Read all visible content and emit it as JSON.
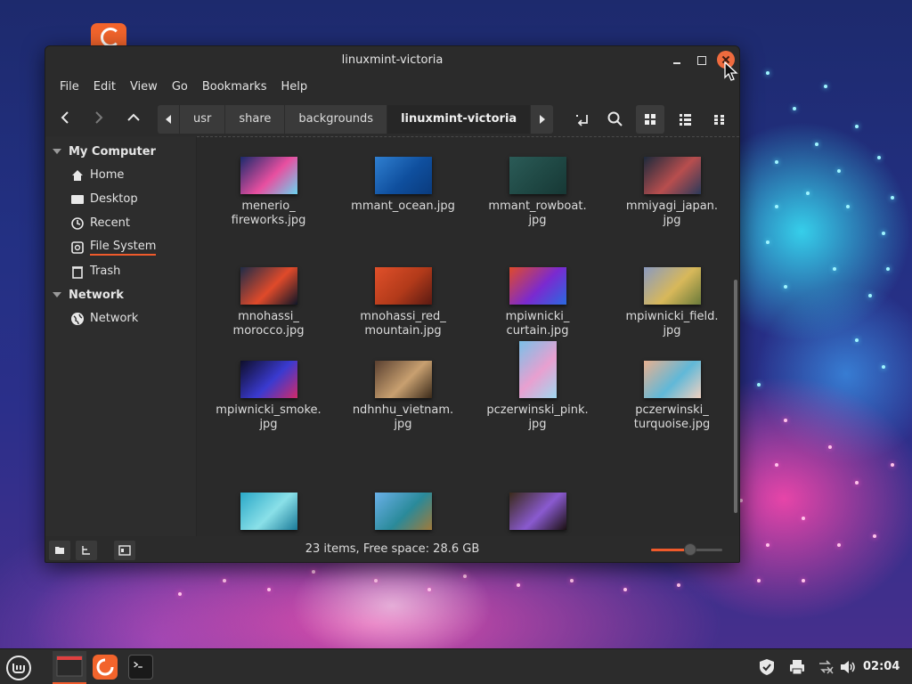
{
  "window": {
    "title": "linuxmint-victoria"
  },
  "menu": [
    "File",
    "Edit",
    "View",
    "Go",
    "Bookmarks",
    "Help"
  ],
  "breadcrumbs": [
    "usr",
    "share",
    "backgrounds",
    "linuxmint-victoria"
  ],
  "sidebar": {
    "sections": [
      {
        "title": "My Computer",
        "items": [
          {
            "label": "Home",
            "icon": "home-icon"
          },
          {
            "label": "Desktop",
            "icon": "desktop-icon"
          },
          {
            "label": "Recent",
            "icon": "clock-icon"
          },
          {
            "label": "File System",
            "icon": "drive-icon",
            "selected": true
          },
          {
            "label": "Trash",
            "icon": "trash-icon"
          }
        ]
      },
      {
        "title": "Network",
        "items": [
          {
            "label": "Network",
            "icon": "globe-icon"
          }
        ]
      }
    ]
  },
  "files": [
    {
      "name": "menerio_\nfireworks.jpg",
      "colors": [
        "#1a2a6c",
        "#e84fa0",
        "#6ad3f0"
      ],
      "tall": false
    },
    {
      "name": "mmant_ocean.jpg",
      "colors": [
        "#2f7fd0",
        "#0f4f9e",
        "#0a3b7d"
      ],
      "tall": false
    },
    {
      "name": "mmant_rowboat.\njpg",
      "colors": [
        "#2b5b57",
        "#1f4844",
        "#173835"
      ],
      "tall": false
    },
    {
      "name": "mmiyagi_japan.\njpg",
      "colors": [
        "#1c2a3c",
        "#b84e4e",
        "#2a3a5a"
      ],
      "tall": false
    },
    {
      "name": "mnohassi_\nmorocco.jpg",
      "colors": [
        "#1e2c48",
        "#e04a2a",
        "#0e1628"
      ],
      "tall": false
    },
    {
      "name": "mnohassi_red_\nmountain.jpg",
      "colors": [
        "#e0502a",
        "#b23a1a",
        "#5a1a12"
      ],
      "tall": false
    },
    {
      "name": "mpiwnicki_\ncurtain.jpg",
      "colors": [
        "#e04a2a",
        "#7a2ad0",
        "#2a6ae0"
      ],
      "tall": false
    },
    {
      "name": "mpiwnicki_field.\njpg",
      "colors": [
        "#8a9ac0",
        "#d8b85a",
        "#6a7a3a"
      ],
      "tall": false
    },
    {
      "name": "mpiwnicki_smoke.\njpg",
      "colors": [
        "#0e0e2a",
        "#3a3ad0",
        "#d02a6a"
      ],
      "tall": false
    },
    {
      "name": "ndhnhu_vietnam.\njpg",
      "colors": [
        "#5a4030",
        "#c8a070",
        "#3a2a1a"
      ],
      "tall": false
    },
    {
      "name": "pczerwinski_pink.\njpg",
      "colors": [
        "#7ac0e8",
        "#e8a0d0",
        "#a0d8f0"
      ],
      "tall": true
    },
    {
      "name": "pczerwinski_\nturquoise.jpg",
      "colors": [
        "#e8b090",
        "#60b8d8",
        "#f0d0c0"
      ],
      "tall": false
    },
    {
      "name": "",
      "colors": [
        "#2aa8c8",
        "#8ae0e8",
        "#1a7a98"
      ],
      "tall": false
    },
    {
      "name": "",
      "colors": [
        "#6ab0e8",
        "#2a8a9a",
        "#a07a3a"
      ],
      "tall": false
    },
    {
      "name": "",
      "colors": [
        "#3a2a1a",
        "#8a5ad0",
        "#1a1010"
      ],
      "tall": false
    }
  ],
  "status": {
    "text": "23 items, Free space: 28.6 GB",
    "zoom_level": 0.55
  },
  "taskbar": {
    "clock": "02:04"
  },
  "colors": {
    "accent": "#ef5a2b",
    "window_bg": "#2f2f2f",
    "panel_bg": "#2c2c2c"
  }
}
